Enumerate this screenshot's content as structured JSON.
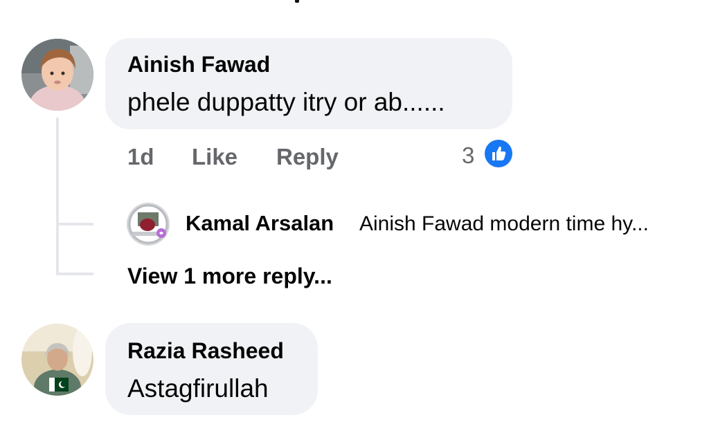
{
  "comments": [
    {
      "author": "Ainish Fawad",
      "text": "phele duppatty itry or ab......",
      "time": "1d",
      "like_label": "Like",
      "reply_label": "Reply",
      "reaction_count": "3",
      "reaction_icon": "like-icon",
      "replies": [
        {
          "author": "Kamal Arsalan",
          "text": "Ainish Fawad modern time hy..."
        }
      ],
      "more_replies_label": "View 1 more reply..."
    },
    {
      "author": "Razia Rasheed",
      "text": "Astagfirullah"
    }
  ],
  "colors": {
    "bubble": "#f0f2f5",
    "meta_text": "#65676b",
    "like_blue": "#1877f2",
    "thread_line": "#e4e6eb"
  }
}
